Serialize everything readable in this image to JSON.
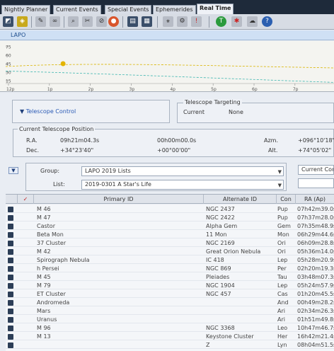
{
  "tabs": [
    {
      "label": "Nightly Planner"
    },
    {
      "label": "Current Events"
    },
    {
      "label": "Special Events"
    },
    {
      "label": "Ephemerides"
    },
    {
      "label": "Real Time"
    }
  ],
  "lapo_label": "LAPO",
  "chart_data": {
    "type": "line",
    "y_ticks": [
      "75",
      "60",
      "45",
      "30",
      "15"
    ],
    "x_ticks": [
      "12p",
      "1p",
      "2p",
      "3p",
      "4p",
      "5p",
      "6p",
      "7p"
    ],
    "marker": {
      "x": "1:20p",
      "y": 45
    }
  },
  "telescope_control": {
    "label": "Telescope Control"
  },
  "telescope_targeting": {
    "title": "Telescope Targeting",
    "current_label": "Current",
    "current_value": "None"
  },
  "position": {
    "title": "Current Telescope Position",
    "ra_label": "R.A.",
    "ra_value": "09h21m04.3s",
    "ra_offset": "00h00m00.0s",
    "dec_label": "Dec.",
    "dec_value": "+34°23'40\"",
    "dec_offset": "+00°00'00\"",
    "azm_label": "Azm.",
    "azm_value": "+096°10'18\"",
    "alt_label": "Alt.",
    "alt_value": "+74°05'02\""
  },
  "filters": {
    "group_label": "Group:",
    "group_value": "LAPO 2019 Lists",
    "list_label": "List:",
    "list_value": "2019-0301  A Star's Life",
    "right_value": "Current Con"
  },
  "table": {
    "headers": {
      "check": "✓",
      "primary": "Primary ID",
      "alternate": "Alternate ID",
      "con": "Con",
      "ra": "RA (Ap)"
    },
    "rows": [
      {
        "primary": "M 46",
        "alternate": "NGC 2437",
        "con": "Pup",
        "ra": "07h42m39.0s"
      },
      {
        "primary": "M 47",
        "alternate": "NGC 2422",
        "con": "Pup",
        "ra": "07h37m28.0s"
      },
      {
        "primary": "Castor",
        "alternate": "Alpha Gem",
        "con": "Gem",
        "ra": "07h35m48.9s"
      },
      {
        "primary": "Beta Mon",
        "alternate": "11 Mon",
        "con": "Mon",
        "ra": "06h29m44.6s"
      },
      {
        "primary": "37 Cluster",
        "alternate": "NGC 2169",
        "con": "Ori",
        "ra": "06h09m28.8s"
      },
      {
        "primary": "M 42",
        "alternate": "Great Orion Nebula",
        "con": "Ori",
        "ra": "05h36m14.0s"
      },
      {
        "primary": "Spirograph Nebula",
        "alternate": "IC 418",
        "con": "Lep",
        "ra": "05h28m20.9s"
      },
      {
        "primary": "h Persei",
        "alternate": "NGC 869",
        "con": "Per",
        "ra": "02h20m19.3s"
      },
      {
        "primary": "M 45",
        "alternate": "Pleiades",
        "con": "Tau",
        "ra": "03h48m07.3s"
      },
      {
        "primary": "M 79",
        "alternate": "NGC 1904",
        "con": "Lep",
        "ra": "05h24m57.9s"
      },
      {
        "primary": "ET Cluster",
        "alternate": "NGC 457",
        "con": "Cas",
        "ra": "01h20m45.5s"
      },
      {
        "primary": "Andromeda",
        "alternate": "",
        "con": "And",
        "ra": "00h49m28.2s"
      },
      {
        "primary": "Mars",
        "alternate": "",
        "con": "Ari",
        "ra": "02h34m26.3s"
      },
      {
        "primary": "Uranus",
        "alternate": "",
        "con": "Ari",
        "ra": "01h51m49.8s"
      },
      {
        "primary": "M 96",
        "alternate": "NGC 3368",
        "con": "Leo",
        "ra": "10h47m46.7s"
      },
      {
        "primary": "M 13",
        "alternate": "Keystone Cluster",
        "con": "Her",
        "ra": "16h42m21.4s"
      },
      {
        "primary": "",
        "alternate": "Z",
        "con": "Lyn",
        "ra": "08h04m51.5s"
      }
    ]
  },
  "colors": {
    "accent": "#2a5ab5",
    "chart_line_yellow": "#d9b400",
    "chart_line_cyan": "#3fb6b0",
    "marker": "#e3b400"
  }
}
